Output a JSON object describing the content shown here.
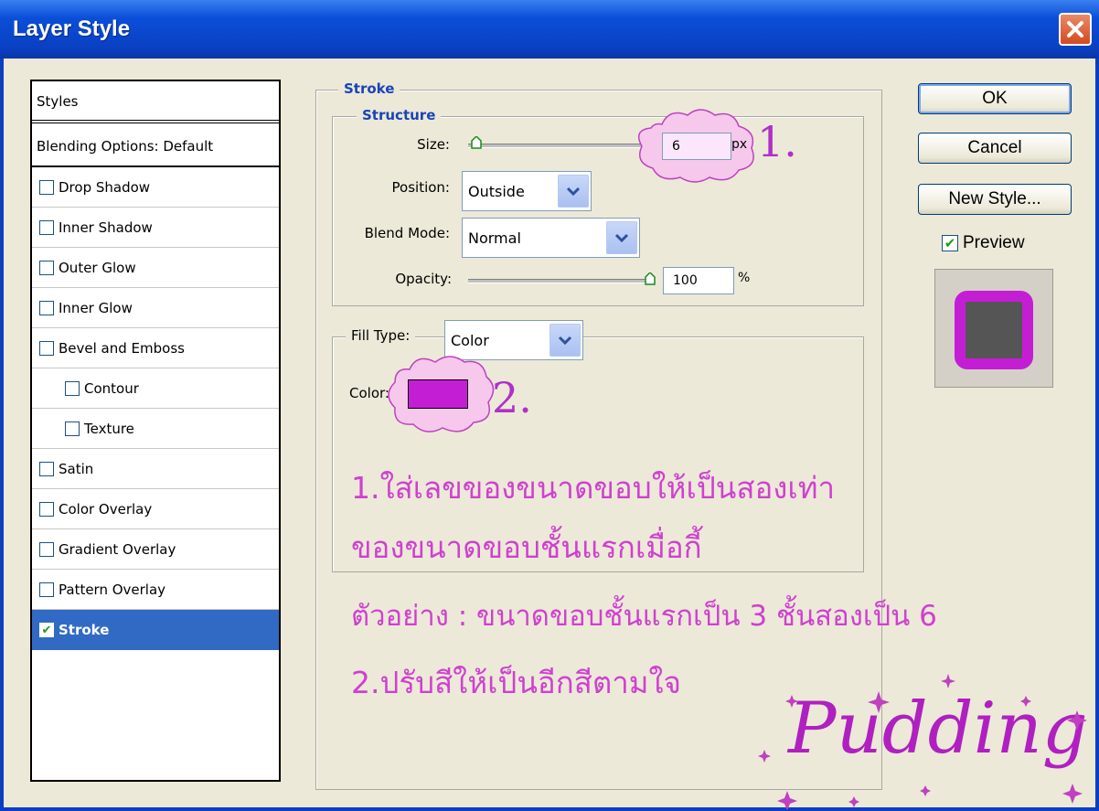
{
  "window": {
    "title": "Layer Style"
  },
  "sidebar": {
    "header": "Styles",
    "blending": "Blending Options: Default",
    "items": [
      {
        "label": "Drop Shadow",
        "checked": false
      },
      {
        "label": "Inner Shadow",
        "checked": false
      },
      {
        "label": "Outer Glow",
        "checked": false
      },
      {
        "label": "Inner Glow",
        "checked": false
      },
      {
        "label": "Bevel and Emboss",
        "checked": false
      },
      {
        "label": "Contour",
        "checked": false
      },
      {
        "label": "Texture",
        "checked": false
      },
      {
        "label": "Satin",
        "checked": false
      },
      {
        "label": "Color Overlay",
        "checked": false
      },
      {
        "label": "Gradient Overlay",
        "checked": false
      },
      {
        "label": "Pattern Overlay",
        "checked": false
      },
      {
        "label": "Stroke",
        "checked": true,
        "selected": true
      }
    ]
  },
  "stroke": {
    "legend": "Stroke",
    "structure_legend": "Structure",
    "size_label": "Size:",
    "size_value": "6",
    "size_unit": "px",
    "position_label": "Position:",
    "position_value": "Outside",
    "blend_label": "Blend Mode:",
    "blend_value": "Normal",
    "opacity_label": "Opacity:",
    "opacity_value": "100",
    "opacity_unit": "%",
    "filltype_label": "Fill Type:",
    "filltype_value": "Color",
    "color_label": "Color:",
    "stroke_color": "#c41ed4"
  },
  "buttons": {
    "ok": "OK",
    "cancel": "Cancel",
    "new_style": "New Style...",
    "preview": "Preview",
    "preview_checked": true
  },
  "annotations": {
    "mark1": "1.",
    "mark2": "2.",
    "line1": "1.ใส่เลขของขนาดขอบให้เป็นสองเท่า",
    "line2": "ของขนาดขอบชั้นแรกเมื่อกี้",
    "line3": "ตัวอย่าง : ขนาดขอบชั้นแรกเป็น 3 ชั้นสองเป็น 6",
    "line4": "2.ปรับสีให้เป็นอีกสีตามใจ",
    "signature": "Pudding"
  }
}
